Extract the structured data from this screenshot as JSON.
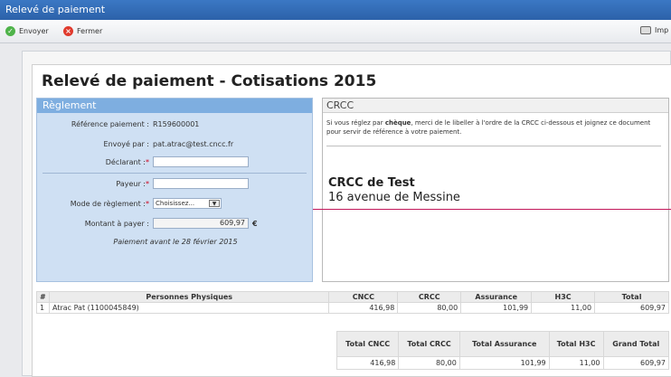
{
  "window": {
    "title": "Relevé de paiement"
  },
  "toolbar": {
    "send_label": "Envoyer",
    "close_label": "Fermer",
    "print_label": "Imp"
  },
  "document": {
    "title": "Relevé de paiement - Cotisations 2015"
  },
  "reglement": {
    "header": "Règlement",
    "ref_label": "Référence paiement :",
    "ref_value": "R159600001",
    "sent_by_label": "Envoyé par :",
    "sent_by_value": "pat.atrac@test.cncc.fr",
    "declarant_label": "Déclarant :",
    "declarant_value": "",
    "payeur_label": "Payeur :",
    "payeur_value": "",
    "mode_label": "Mode de règlement :",
    "mode_selected": "Choisissez...",
    "amount_label": "Montant à payer :",
    "amount_value": "609,97",
    "currency": "€",
    "deadline": "Paiement avant le 28 février 2015",
    "required_mark": "*"
  },
  "crcc": {
    "header": "CRCC",
    "text_pre": "Si vous réglez par ",
    "text_bold": "chèque",
    "text_post": ", merci de le libeller à l'ordre de la CRCC ci-dessous et joignez ce document pour servir de référence à votre paiement.",
    "name": "CRCC de Test",
    "address": "16 avenue de Messine"
  },
  "table1": {
    "headers": [
      "#",
      "Personnes Physiques",
      "CNCC",
      "CRCC",
      "Assurance",
      "H3C",
      "Total"
    ],
    "rows": [
      [
        "1",
        "Atrac Pat (1100045849)",
        "416,98",
        "80,00",
        "101,99",
        "11,00",
        "609,97"
      ]
    ]
  },
  "table2": {
    "headers": [
      "Total CNCC",
      "Total CRCC",
      "Total Assurance",
      "Total H3C",
      "Grand Total"
    ],
    "rows": [
      [
        "416,98",
        "80,00",
        "101,99",
        "11,00",
        "609,97"
      ]
    ]
  }
}
